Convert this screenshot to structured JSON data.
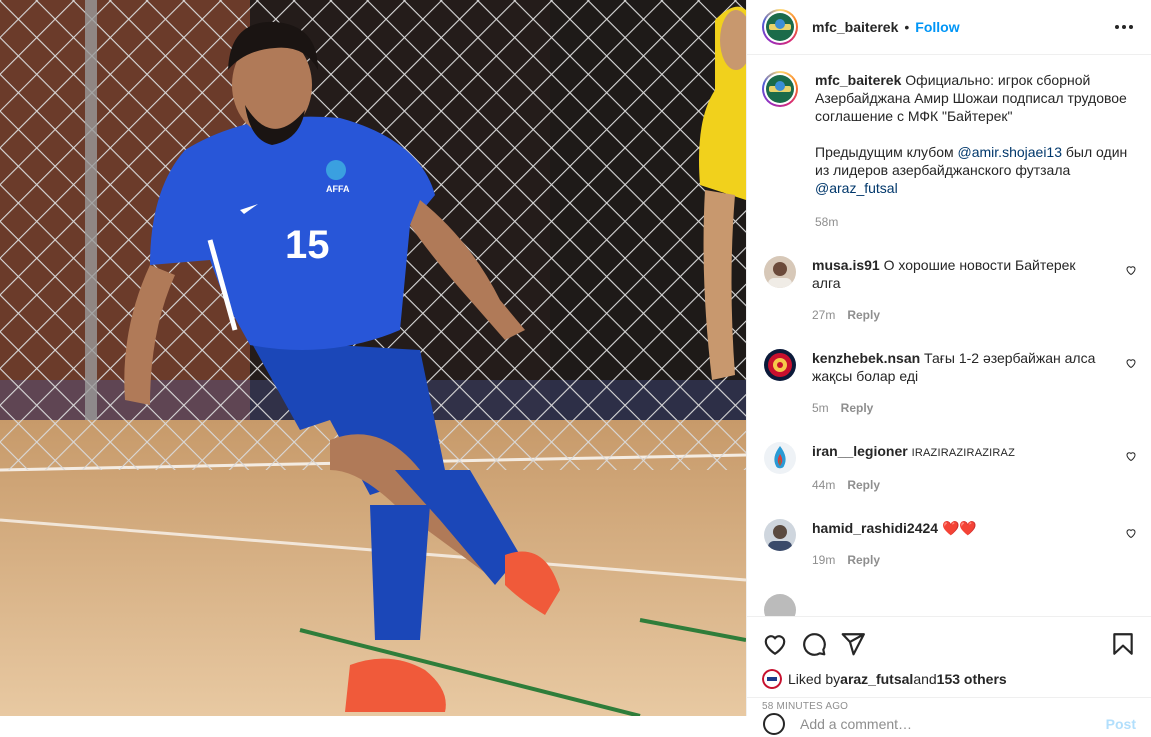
{
  "post": {
    "author": "mfc_baiterek",
    "follow_label": "Follow",
    "separator": "•",
    "caption": "Официально: игрок сборной Азербайджана Амир Шожаи подписал трудовое соглашение с МФК \"Байтерек\"\n\nПредыдущим клубом ",
    "caption_mention_1": "@amir.shojaei13",
    "caption_mid": " был один из лидеров азербайджанского футзала ",
    "caption_mention_2": "@araz_futsal",
    "caption_age": "58m"
  },
  "photo": {
    "jersey_number": "15",
    "badge_text": "AFFA"
  },
  "comments": [
    {
      "user": "musa.is91",
      "text": "О хорошие новости Байтерек алга",
      "age": "27m",
      "reply_label": "Reply"
    },
    {
      "user": "kenzhebek.nsan",
      "text": "Тағы 1-2 әзербайжан алса жақсы болар еді",
      "age": "5m",
      "reply_label": "Reply"
    },
    {
      "user": "iran__legioner",
      "text": "IRAZIRAZIRAZIRAZ",
      "age": "44m",
      "reply_label": "Reply"
    },
    {
      "user": "hamid_rashidi2424",
      "text": "❤️❤️",
      "age": "19m",
      "reply_label": "Reply"
    }
  ],
  "actions": {
    "liked_by_prefix": "Liked by ",
    "liked_by_user": "araz_futsal",
    "liked_by_and": " and ",
    "liked_by_count": "153 others",
    "timestamp": "58 minutes ago",
    "add_comment_placeholder": "Add a comment…",
    "post_label": "Post"
  },
  "icons": {
    "like": "heart-icon",
    "comment": "comment-icon",
    "share": "paper-plane-icon",
    "save": "bookmark-icon",
    "more": "more-options-icon",
    "emoji": "emoji-icon"
  },
  "colors": {
    "link": "#0095f6",
    "mention": "#00376b",
    "muted": "#8e8e8e",
    "heart": "#ed4956"
  }
}
